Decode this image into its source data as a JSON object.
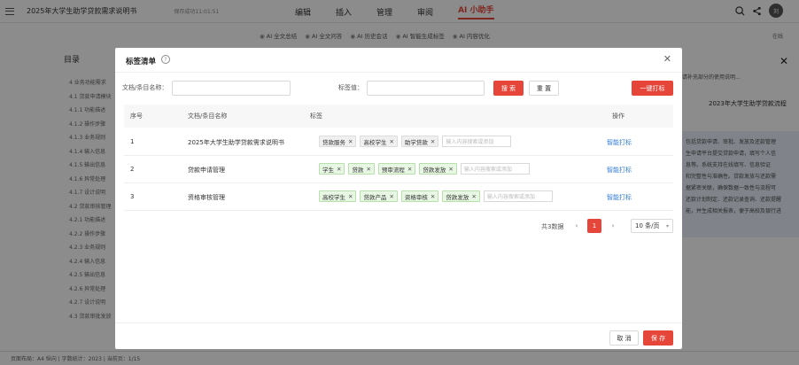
{
  "topbar": {
    "doc_title": "2025年大学生助学贷款需求说明书",
    "save_status": "保存成功11:01:51",
    "nav": [
      "编辑",
      "插入",
      "管理",
      "审阅",
      "AI 小助手"
    ],
    "avatar": "刘"
  },
  "subtoolbar": {
    "items": [
      "AI 全文总结",
      "AI 全文问答",
      "AI 历史会话",
      "AI 智能生成标签",
      "AI 内容优化"
    ],
    "online": "在线"
  },
  "left_panel": {
    "title": "目录",
    "items": [
      "4 业务功能需求",
      "4.1 贷款申请模块",
      "4.1.1 功能描述",
      "4.1.2 操作步骤",
      "4.1.3 业务规则",
      "4.1.4 输入信息",
      "4.1.5 输出信息",
      "4.1.6 异常处理",
      "4.1.7 设计说明",
      "4.2 贷款审核管理",
      "4.2.1 功能描述",
      "4.2.2 操作步骤",
      "4.2.3 业务规则",
      "4.2.4 输入信息",
      "4.2.5 输出信息",
      "4.2.6 异常处理",
      "4.2.7 设计说明",
      "4.3 贷款审批发放"
    ]
  },
  "right_panel": {
    "text": "请补充部分的使用说明...",
    "chip": "2023年大学生助学贷款流程",
    "block_lines": [
      "包括贷款申请、审批、发放及还款管理",
      "生申请平台提交贷款申请，填写个人信",
      "息等。系统支持在线填写、信息验证",
      "和完整性与准确性。贷款发放与还款需",
      "据紧密关联，确保数据一致性与流程可",
      "还款计划制定、还款记录查询、还款提醒",
      "能，并生成相关报表，便于高校及银行进"
    ]
  },
  "modal": {
    "title": "标签清单",
    "filter": {
      "name_label": "文档/条目名称：",
      "tag_label": "标签值：",
      "search_btn": "搜 索",
      "reset_btn": "重 置",
      "batch_btn": "一键打标"
    },
    "columns": [
      "序号",
      "文档/条目名称",
      "标签",
      "操作"
    ],
    "rows": [
      {
        "no": "1",
        "name": "2025年大学生助学贷款需求说明书",
        "tags": [
          "贷款服务",
          "高校学生",
          "助学贷款"
        ],
        "placeholder": "输入内容搜索或添加",
        "action": "智能打标"
      },
      {
        "no": "2",
        "name": "贷款申请管理",
        "tags": [
          "学生",
          "贷款",
          "预审流程",
          "贷款发放"
        ],
        "placeholder": "输入内容搜索或添加",
        "action": "智能打标"
      },
      {
        "no": "3",
        "name": "资格审核管理",
        "tags": [
          "高校学生",
          "贷款产品",
          "资格审核",
          "贷款发放"
        ],
        "placeholder": "输入内容搜索或添加",
        "action": "智能打标"
      }
    ],
    "pagination": {
      "total": "共3数据",
      "current": "1",
      "page_size": "10 条/页"
    },
    "footer": {
      "cancel": "取 消",
      "save": "保 存"
    }
  },
  "statusbar": {
    "text": "页面布局：A4 纵向 | 字数统计：2023 | 当前页：1/15"
  },
  "colors": {
    "accent": "#e6453a",
    "link": "#2f7bd9",
    "tag_green": "#e8f7e4"
  }
}
